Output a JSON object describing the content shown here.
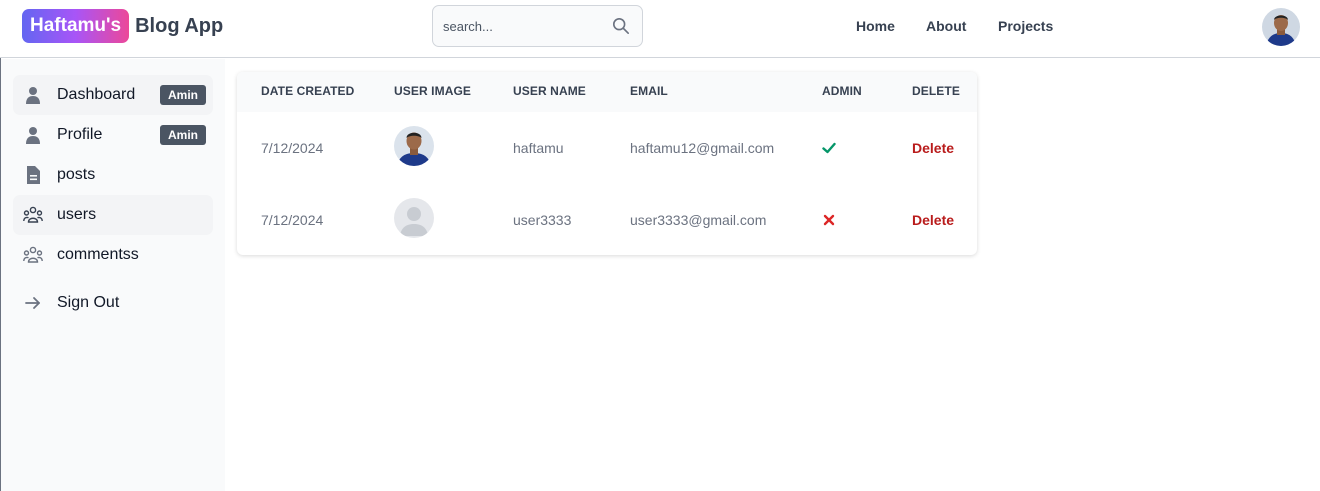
{
  "header": {
    "brand_pill": "Haftamu's",
    "brand_text": "Blog App",
    "search_placeholder": "search...",
    "nav": {
      "home": "Home",
      "about": "About",
      "projects": "Projects"
    }
  },
  "sidebar": {
    "items": [
      {
        "label": "Dashboard",
        "badge": "Amin",
        "icon": "user-icon"
      },
      {
        "label": "Profile",
        "badge": "Amin",
        "icon": "user-icon"
      },
      {
        "label": "posts",
        "icon": "document-icon"
      },
      {
        "label": "users",
        "icon": "users-group-icon"
      },
      {
        "label": "commentss",
        "icon": "users-group-icon"
      },
      {
        "label": "Sign Out",
        "icon": "arrow-right-icon"
      }
    ]
  },
  "table": {
    "headers": [
      "DATE CREATED",
      "USER IMAGE",
      "USER NAME",
      "EMAIL",
      "ADMIN",
      "DELETE"
    ],
    "rows": [
      {
        "date": "7/12/2024",
        "image": "profile-photo",
        "username": "haftamu",
        "email": "haftamu12@gmail.com",
        "admin": true,
        "delete": "Delete"
      },
      {
        "date": "7/12/2024",
        "image": "default-avatar",
        "username": "user3333",
        "email": "user3333@gmail.com",
        "admin": false,
        "delete": "Delete"
      }
    ]
  },
  "colors": {
    "admin_yes": "#059669",
    "admin_no": "#dc2626",
    "delete_text": "#b91c1c",
    "badge_bg": "#4b5563"
  }
}
